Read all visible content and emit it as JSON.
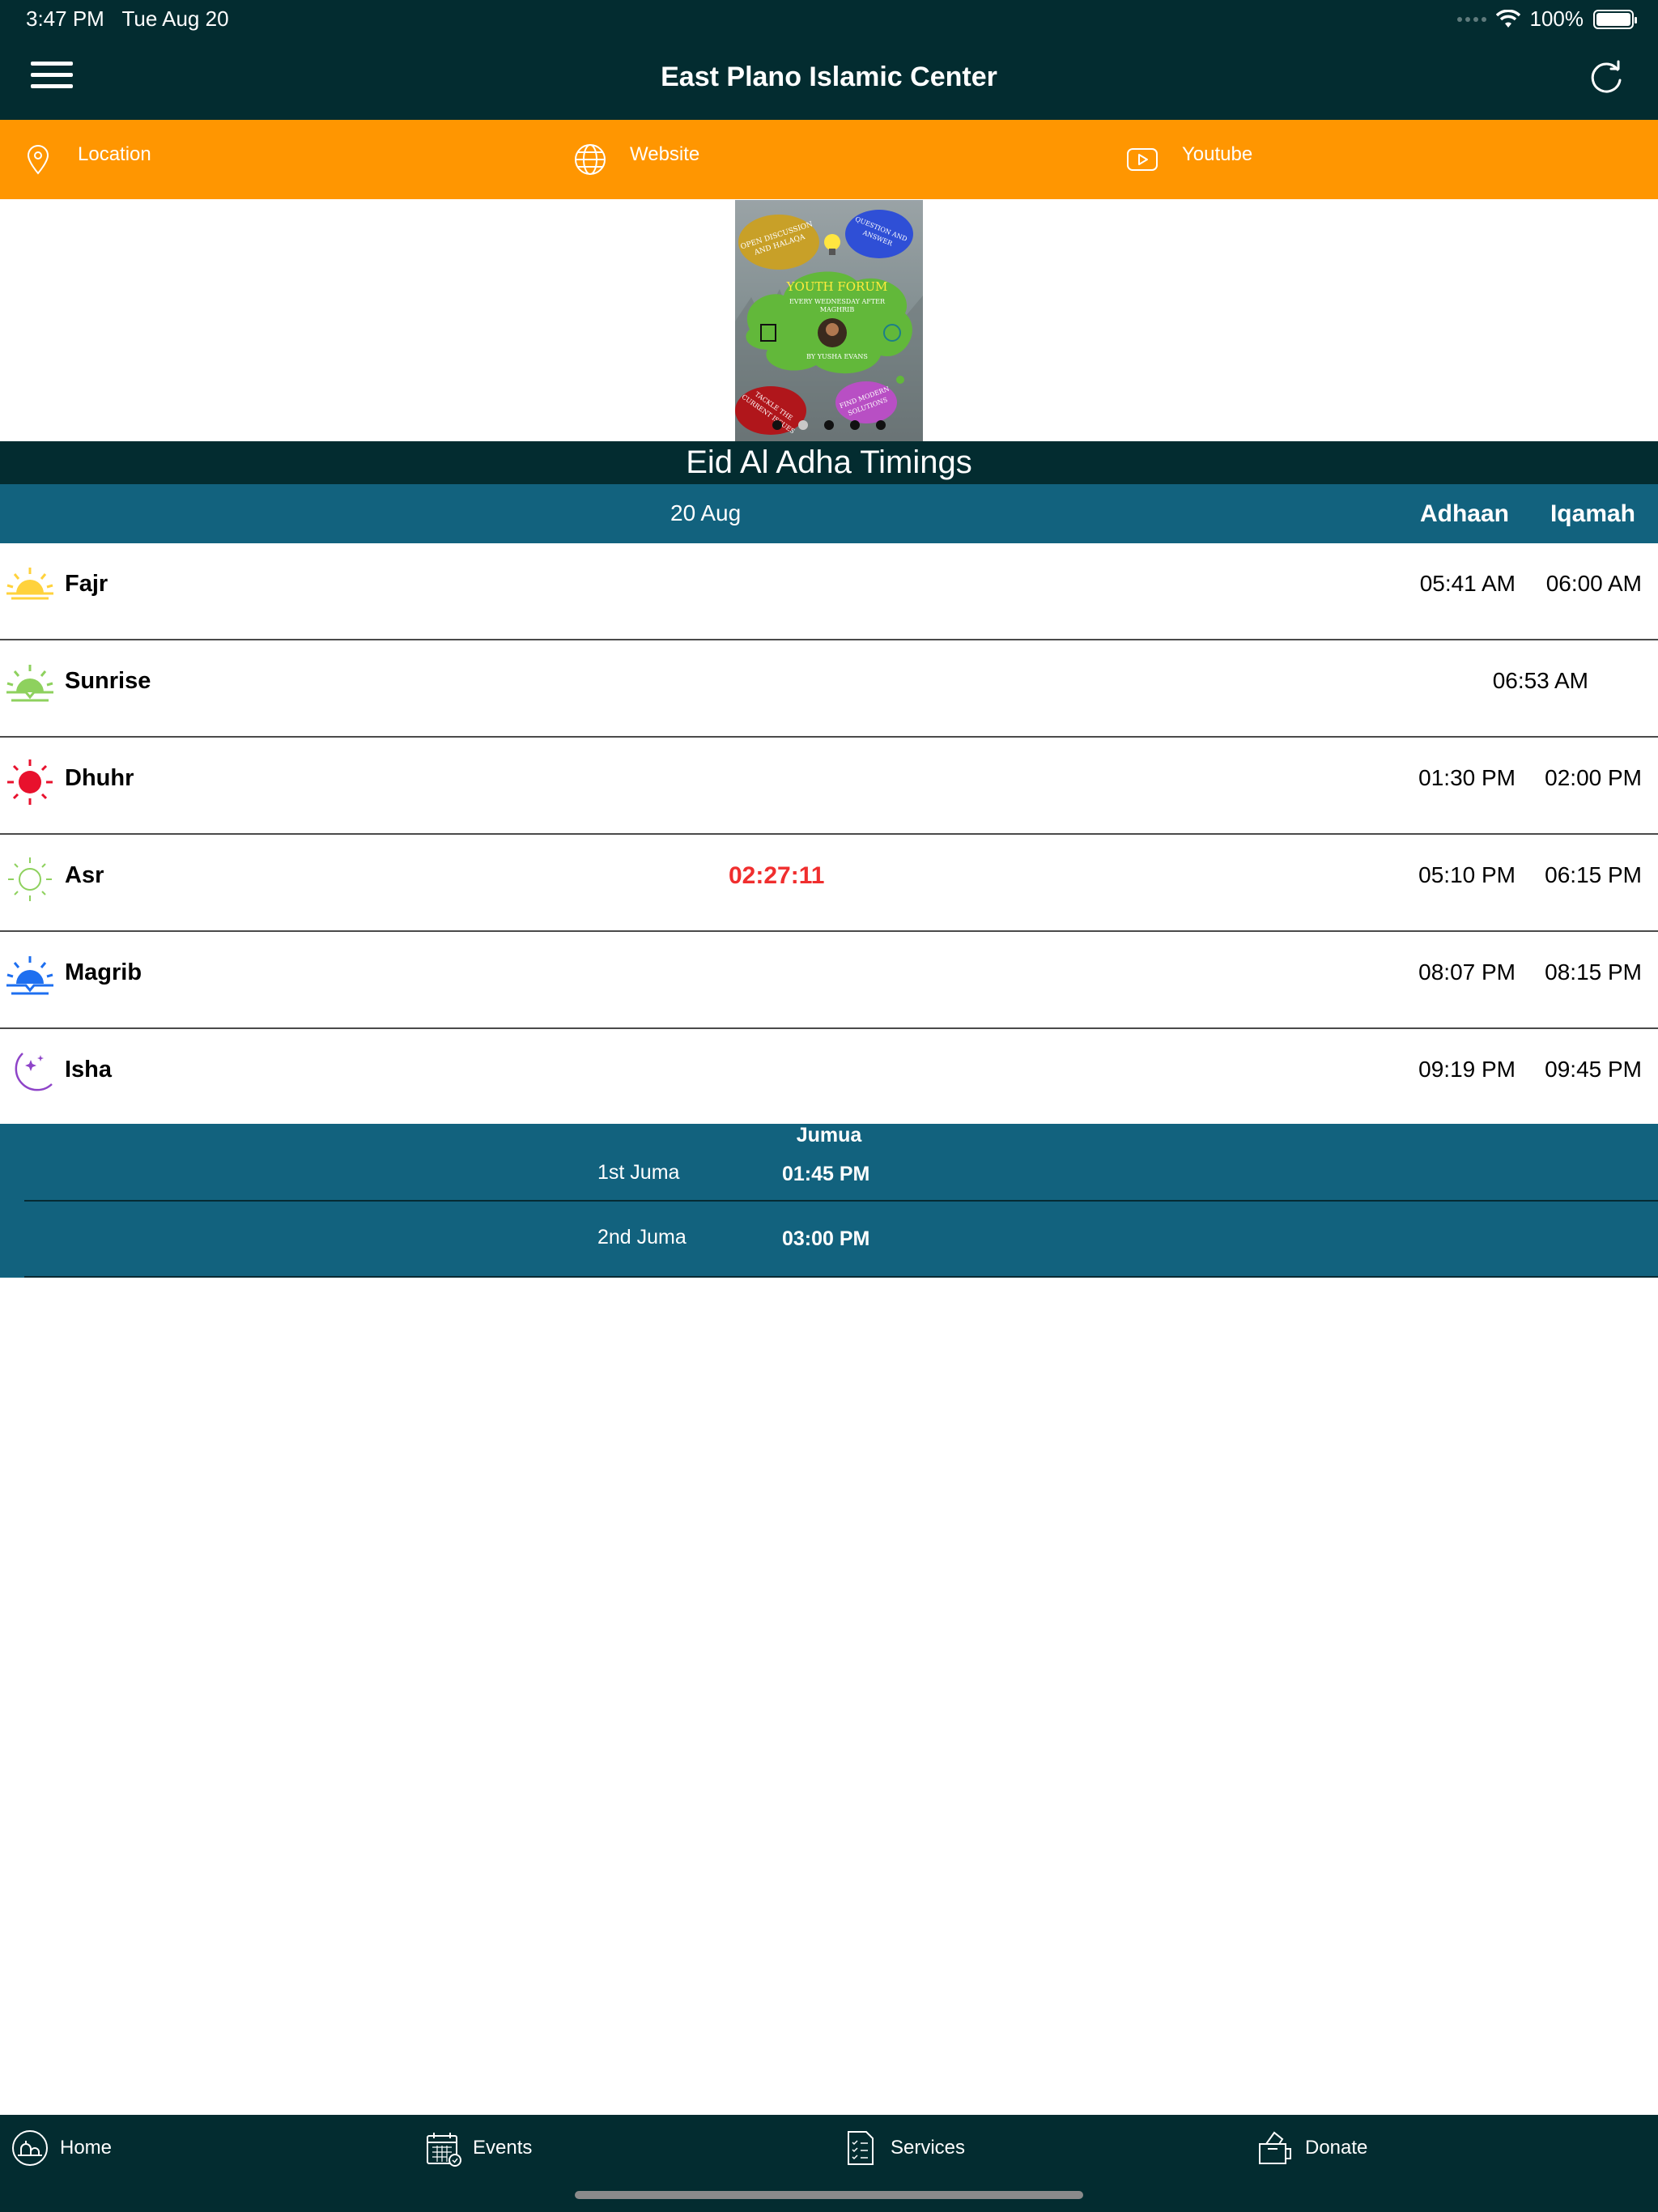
{
  "status_bar": {
    "time": "3:47 PM",
    "date": "Tue Aug 20",
    "battery": "100%"
  },
  "header": {
    "title": "East Plano Islamic Center"
  },
  "links": [
    {
      "label": "Location",
      "icon": "location-pin-icon"
    },
    {
      "label": "Website",
      "icon": "globe-icon"
    },
    {
      "label": "Youtube",
      "icon": "youtube-play-icon"
    }
  ],
  "banner": {
    "heading": "Youth Forum",
    "subheading": "Every Wednesday After Maghrib",
    "byline": "By Yusha Evans",
    "bubbles": [
      "Open Discussion and Halaqa",
      "Question and Answer",
      "Tackle the Current Issues",
      "Find Modern Solutions"
    ],
    "slide_count": 5,
    "active_slide": 2
  },
  "event_title": "Eid Al Adha Timings",
  "table_header": {
    "date": "20 Aug",
    "adhaan": "Adhaan",
    "iqamah": "Iqamah"
  },
  "prayers": [
    {
      "name": "Fajr",
      "adhaan": "05:41 AM",
      "iqamah": "06:00 AM",
      "icon": "sunrise-yellow-icon"
    },
    {
      "name": "Sunrise",
      "time": "06:53 AM",
      "icon": "sunrise-green-icon"
    },
    {
      "name": "Dhuhr",
      "adhaan": "01:30 PM",
      "iqamah": "02:00 PM",
      "icon": "sun-red-icon"
    },
    {
      "name": "Asr",
      "countdown": "02:27:11",
      "adhaan": "05:10 PM",
      "iqamah": "06:15 PM",
      "icon": "sun-outline-icon"
    },
    {
      "name": "Magrib",
      "adhaan": "08:07 PM",
      "iqamah": "08:15 PM",
      "icon": "sunset-blue-icon"
    },
    {
      "name": "Isha",
      "adhaan": "09:19 PM",
      "iqamah": "09:45 PM",
      "icon": "moon-purple-icon"
    }
  ],
  "jumua": {
    "title": "Jumua",
    "rows": [
      {
        "label": "1st Juma",
        "time": "01:45 PM"
      },
      {
        "label": "2nd Juma",
        "time": "03:00 PM"
      }
    ]
  },
  "tabs": [
    {
      "label": "Home",
      "icon": "mosque-home-icon"
    },
    {
      "label": "Events",
      "icon": "calendar-icon"
    },
    {
      "label": "Services",
      "icon": "checklist-icon"
    },
    {
      "label": "Donate",
      "icon": "donation-box-icon"
    }
  ],
  "colors": {
    "dark": "#032c30",
    "orange": "#ff9601",
    "teal": "#12627e",
    "countdown": "#f02e2e"
  }
}
